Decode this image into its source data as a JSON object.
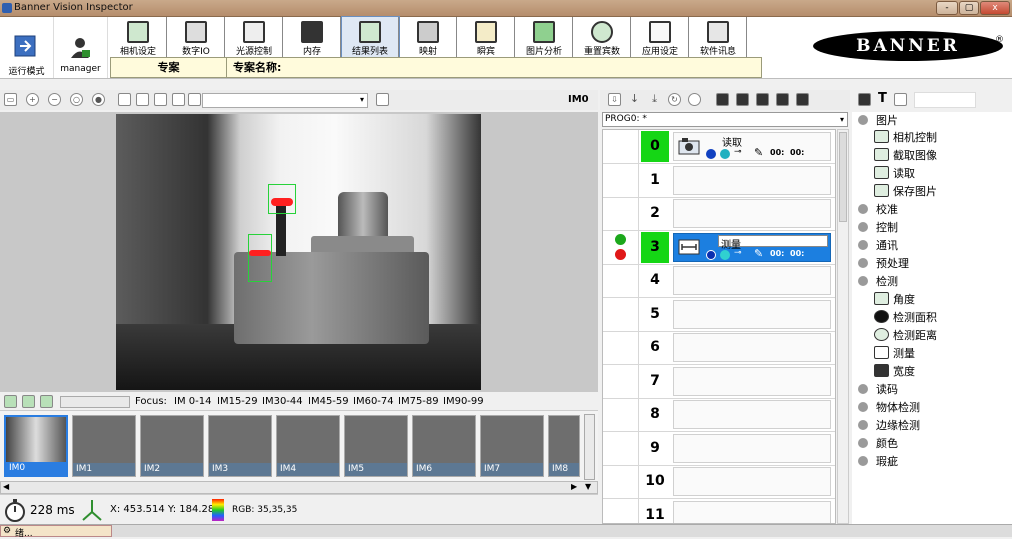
{
  "window": {
    "title": "Banner Vision Inspector",
    "controls": [
      "-",
      "▢",
      "x"
    ]
  },
  "mode_buttons": [
    {
      "label": "运行模式",
      "icon": "run-mode-icon"
    },
    {
      "label": "manager",
      "icon": "user-icon"
    }
  ],
  "toolbar": {
    "tools": [
      {
        "label": "相机设定",
        "icon": "camera-settings-icon"
      },
      {
        "label": "数字IO",
        "icon": "digital-io-icon"
      },
      {
        "label": "光源控制",
        "icon": "light-control-icon"
      },
      {
        "label": "内存",
        "icon": "hdd-memory-icon"
      },
      {
        "label": "结果列表",
        "icon": "results-list-icon"
      },
      {
        "label": "映射",
        "icon": "mapping-icon"
      },
      {
        "label": "瞬宾",
        "icon": "grid-icon"
      },
      {
        "label": "图片分析",
        "icon": "image-analysis-icon"
      },
      {
        "label": "重置宾数",
        "icon": "reset-counters-icon"
      },
      {
        "label": "应用设定",
        "icon": "app-settings-icon"
      },
      {
        "label": "软件讯息",
        "icon": "software-info-icon"
      }
    ],
    "job_label": "专案",
    "job_name_label": "专案名称:"
  },
  "brand": {
    "logo_text": "BANNER",
    "registered": "®"
  },
  "image_toolbar": {
    "image_label": "IM0"
  },
  "focus": {
    "label": "Focus:",
    "ranges": [
      "IM 0-14",
      "IM15-29",
      "IM30-44",
      "IM45-59",
      "IM60-74",
      "IM75-89",
      "IM90-99"
    ]
  },
  "thumbnails": [
    "IM0",
    "IM1",
    "IM2",
    "IM3",
    "IM4",
    "IM5",
    "IM6",
    "IM7",
    "IM8"
  ],
  "status": {
    "time": "228 ms",
    "coords": "X: 453.514  Y: 184.288",
    "rgb": "RGB: 35,35,35"
  },
  "program": {
    "selector": "PROG0: *"
  },
  "steps": [
    {
      "num": "0",
      "name": "读取",
      "active": true,
      "selected": false
    },
    {
      "num": "1",
      "name": "",
      "active": false,
      "selected": false
    },
    {
      "num": "2",
      "name": "",
      "active": false,
      "selected": false
    },
    {
      "num": "3",
      "name": "测量",
      "active": true,
      "selected": true
    },
    {
      "num": "4",
      "name": ""
    },
    {
      "num": "5",
      "name": ""
    },
    {
      "num": "6",
      "name": ""
    },
    {
      "num": "7",
      "name": ""
    },
    {
      "num": "8",
      "name": ""
    },
    {
      "num": "9",
      "name": ""
    },
    {
      "num": "10",
      "name": ""
    },
    {
      "num": "11",
      "name": ""
    }
  ],
  "step_tool_icons": [
    "info-icon",
    "pass-icon",
    "pin-icon",
    "edit-icon",
    "io-icon",
    "io-icon"
  ],
  "tree": {
    "image_group": "图片",
    "image_items": [
      "相机控制",
      "截取图像",
      "读取",
      "保存图片"
    ],
    "groups_a": [
      "校准",
      "控制",
      "通讯",
      "预处理",
      "检测"
    ],
    "inspection_items": [
      "角度",
      "检测面积",
      "检测距离",
      "测量",
      "宽度"
    ],
    "groups_b": [
      "读码",
      "物体检测",
      "边缘检测",
      "颜色",
      "瑕疵"
    ]
  },
  "taskbar": {
    "item": "绪..."
  },
  "colors": {
    "accent": "#1c7fe0",
    "pass_green": "#15d615",
    "roi_green": "#27d23a",
    "marker_red": "#ff2020"
  }
}
